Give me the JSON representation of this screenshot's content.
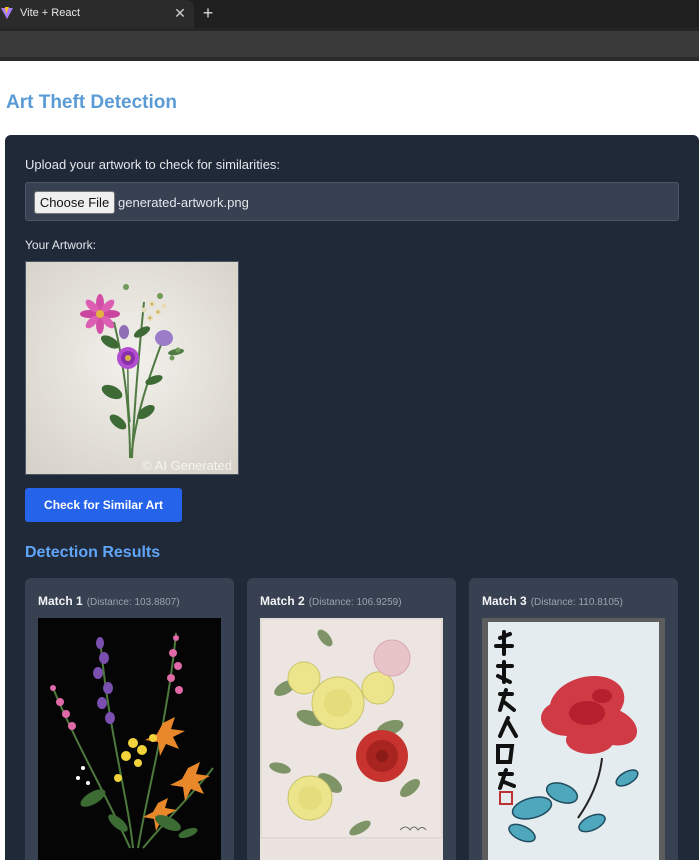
{
  "browser": {
    "tab_title": "Vite + React",
    "close_glyph": "✕",
    "new_tab_glyph": "+"
  },
  "page": {
    "title": "Art Theft Detection",
    "upload_label": "Upload your artwork to check for similarities:",
    "choose_file_label": "Choose File",
    "file_name": "generated-artwork.png",
    "your_artwork_label": "Your Artwork:",
    "watermark": "© AI Generated",
    "check_button": "Check for Similar Art",
    "results_heading": "Detection Results"
  },
  "matches": [
    {
      "title": "Match 1",
      "distance": "(Distance: 103.8807)"
    },
    {
      "title": "Match 2",
      "distance": "(Distance: 106.9259)"
    },
    {
      "title": "Match 3",
      "distance": "(Distance: 110.8105)"
    }
  ],
  "colors": {
    "accent": "#5b9bd5",
    "panel": "#1f2937",
    "card": "#374151",
    "button": "#2563eb"
  }
}
